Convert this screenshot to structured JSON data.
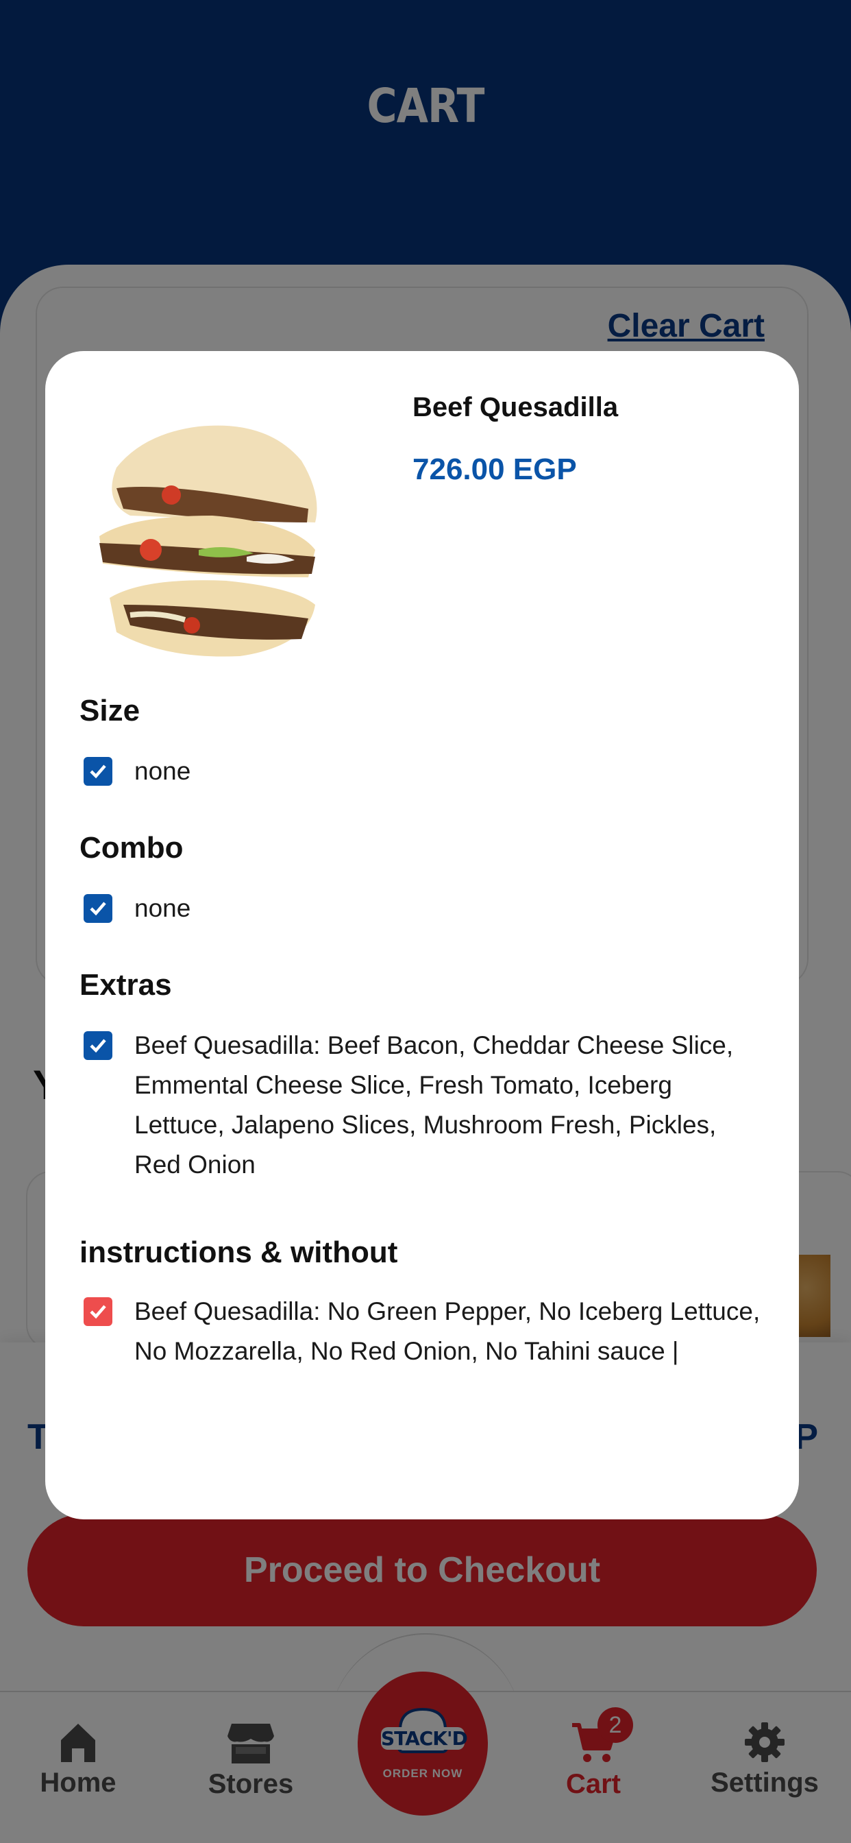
{
  "header": {
    "title": "CART"
  },
  "cart": {
    "clear_label": "Clear Cart"
  },
  "recommendations": {
    "heading": "Y"
  },
  "summary": {
    "total_label": "T",
    "total_value_suffix": "P"
  },
  "checkout": {
    "label": "Proceed to Checkout"
  },
  "tabbar": {
    "home": "Home",
    "stores": "Stores",
    "cart": "Cart",
    "cart_badge": "2",
    "settings": "Settings",
    "order_logo": "STACK'D",
    "order_label": "ORDER NOW"
  },
  "modal": {
    "product_name": "Beef Quesadilla",
    "price": "726.00 EGP",
    "sections": {
      "size": {
        "title": "Size",
        "value": "none"
      },
      "combo": {
        "title": "Combo",
        "value": "none"
      },
      "extras": {
        "title": "Extras",
        "value": "Beef Quesadilla: Beef Bacon, Cheddar Cheese Slice, Emmental Cheese Slice, Fresh Tomato, Iceberg Lettuce, Jalapeno Slices, Mushroom Fresh, Pickles, Red Onion"
      },
      "instructions": {
        "title": "instructions & without",
        "value": "Beef Quesadilla: No Green Pepper, No Iceberg Lettuce, No Mozzarella, No Red Onion, No Tahini sauce |"
      }
    }
  },
  "colors": {
    "brand_blue": "#06347c",
    "accent_blue": "#0a54a8",
    "brand_red": "#e3222a",
    "check_red": "#ee4d4d"
  }
}
